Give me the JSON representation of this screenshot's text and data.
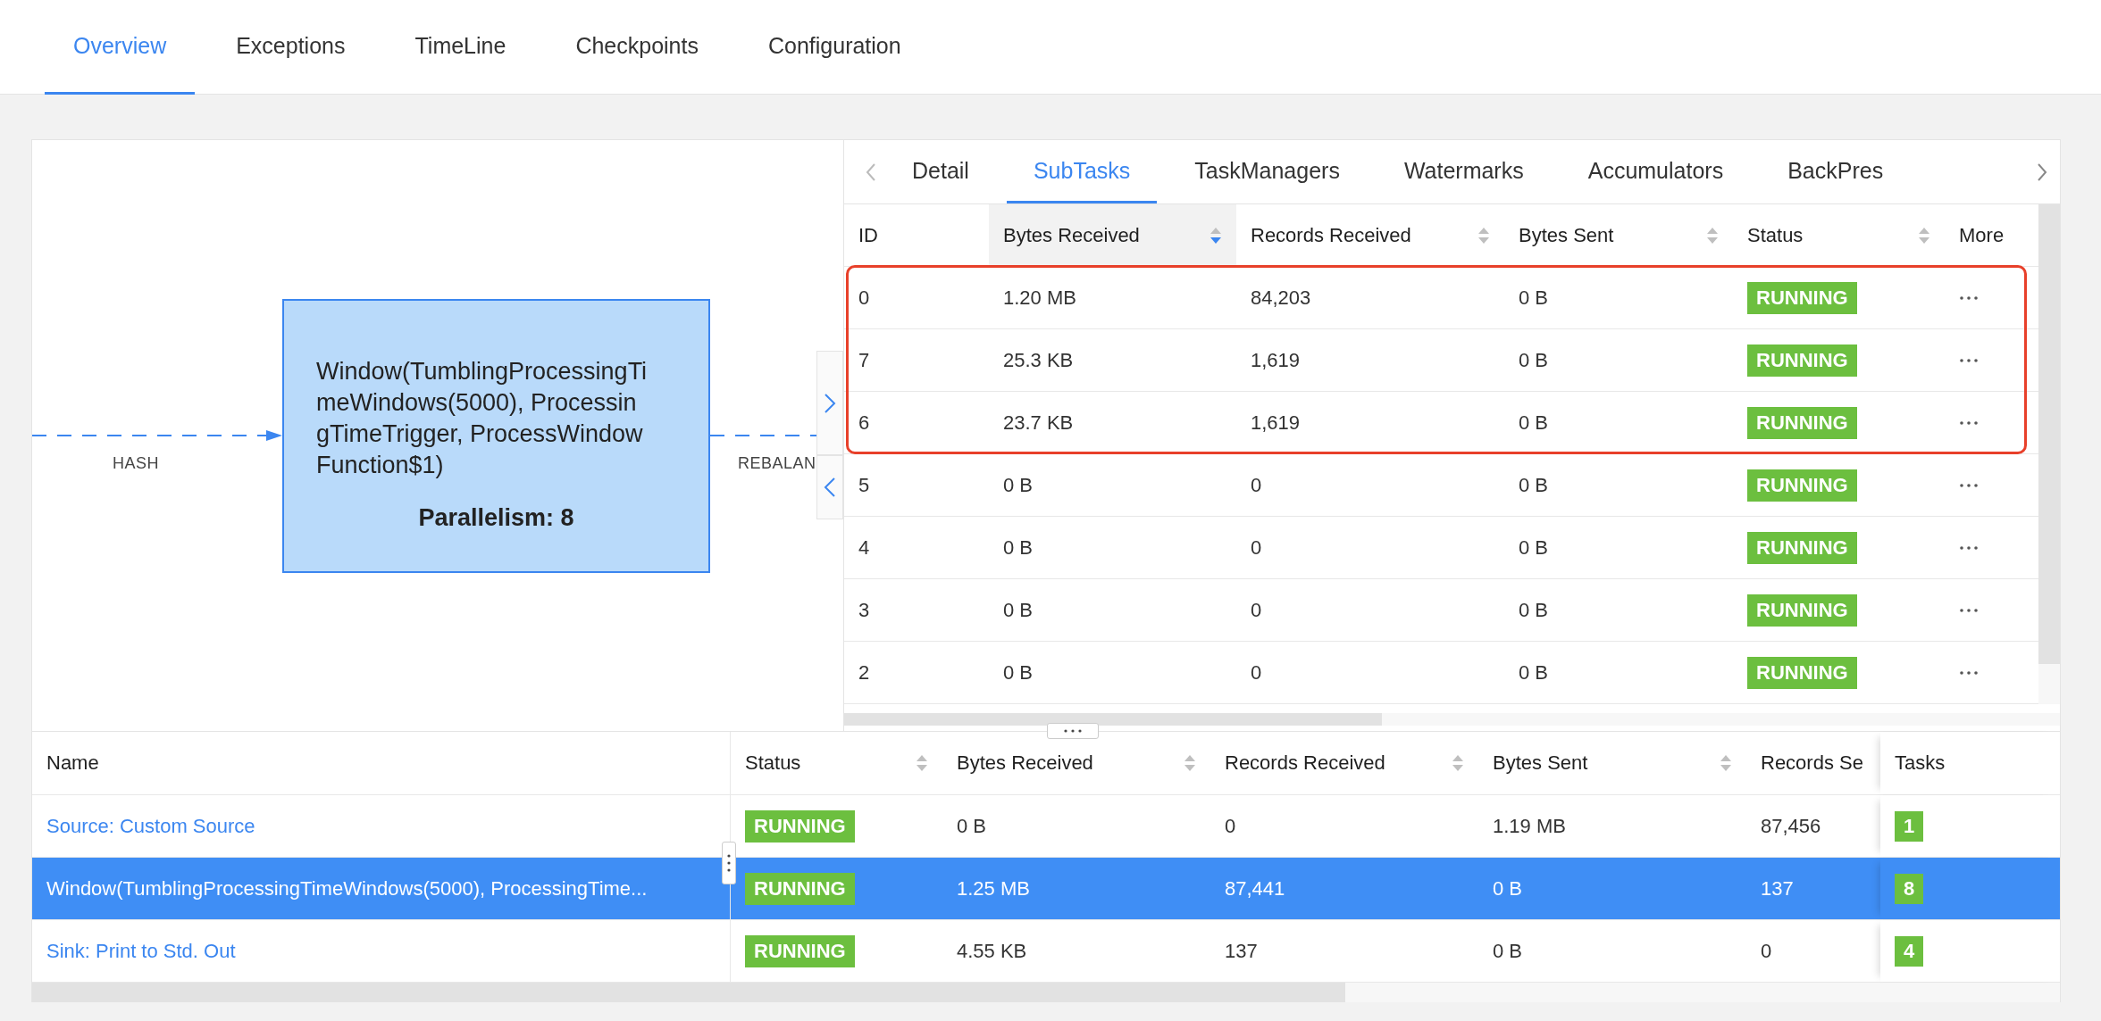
{
  "main_tabs": [
    {
      "label": "Overview",
      "selected": true
    },
    {
      "label": "Exceptions",
      "selected": false
    },
    {
      "label": "TimeLine",
      "selected": false
    },
    {
      "label": "Checkpoints",
      "selected": false
    },
    {
      "label": "Configuration",
      "selected": false
    }
  ],
  "graph": {
    "node": {
      "title": "Window(TumblingProcessingTimeWindows(5000), ProcessingTimeTrigger, ProcessWindowFunction$1)",
      "parallelism": "Parallelism: 8"
    },
    "edges": [
      {
        "label": "HASH"
      },
      {
        "label": "REBALAN"
      }
    ]
  },
  "subtasks": {
    "tabs": [
      {
        "label": "Detail",
        "selected": false
      },
      {
        "label": "SubTasks",
        "selected": true
      },
      {
        "label": "TaskManagers",
        "selected": false
      },
      {
        "label": "Watermarks",
        "selected": false
      },
      {
        "label": "Accumulators",
        "selected": false
      },
      {
        "label": "BackPres",
        "selected": false
      }
    ],
    "columns": [
      {
        "label": "ID"
      },
      {
        "label": "Bytes Received",
        "sortable": true,
        "sorted": true
      },
      {
        "label": "Records Received",
        "sortable": true,
        "sorted": false
      },
      {
        "label": "Bytes Sent",
        "sortable": true,
        "sorted": false
      },
      {
        "label": "Status",
        "sortable": true,
        "sorted": false
      },
      {
        "label": "More"
      }
    ],
    "highlighted_rows": [
      {
        "id": "0",
        "bytes_received": "1.20 MB",
        "records_received": "84,203",
        "bytes_sent": "0 B",
        "status": "RUNNING"
      },
      {
        "id": "7",
        "bytes_received": "25.3 KB",
        "records_received": "1,619",
        "bytes_sent": "0 B",
        "status": "RUNNING"
      },
      {
        "id": "6",
        "bytes_received": "23.7 KB",
        "records_received": "1,619",
        "bytes_sent": "0 B",
        "status": "RUNNING"
      }
    ],
    "rows": [
      {
        "id": "5",
        "bytes_received": "0 B",
        "records_received": "0",
        "bytes_sent": "0 B",
        "status": "RUNNING"
      },
      {
        "id": "4",
        "bytes_received": "0 B",
        "records_received": "0",
        "bytes_sent": "0 B",
        "status": "RUNNING"
      },
      {
        "id": "3",
        "bytes_received": "0 B",
        "records_received": "0",
        "bytes_sent": "0 B",
        "status": "RUNNING"
      },
      {
        "id": "2",
        "bytes_received": "0 B",
        "records_received": "0",
        "bytes_sent": "0 B",
        "status": "RUNNING"
      }
    ]
  },
  "vertices": {
    "columns": [
      {
        "label": "Name"
      },
      {
        "label": "Status",
        "sortable": true,
        "sorted": false
      },
      {
        "label": "Bytes Received",
        "sortable": true,
        "sorted": false
      },
      {
        "label": "Records Received",
        "sortable": true,
        "sorted": false
      },
      {
        "label": "Bytes Sent",
        "sortable": true,
        "sorted": false
      },
      {
        "label": "Records Se"
      },
      {
        "label": "Tasks"
      }
    ],
    "rows": [
      {
        "name": "Source: Custom Source",
        "status": "RUNNING",
        "bytes_received": "0 B",
        "records_received": "0",
        "bytes_sent": "1.19 MB",
        "records_sent": "87,456",
        "tasks": "1",
        "selected": false
      },
      {
        "name": "Window(TumblingProcessingTimeWindows(5000), ProcessingTime...",
        "status": "RUNNING",
        "bytes_received": "1.25 MB",
        "records_received": "87,441",
        "bytes_sent": "0 B",
        "records_sent": "137",
        "tasks": "8",
        "selected": true
      },
      {
        "name": "Sink: Print to Std. Out",
        "status": "RUNNING",
        "bytes_received": "4.55 KB",
        "records_received": "137",
        "bytes_sent": "0 B",
        "records_sent": "0",
        "tasks": "4",
        "selected": false
      }
    ]
  }
}
